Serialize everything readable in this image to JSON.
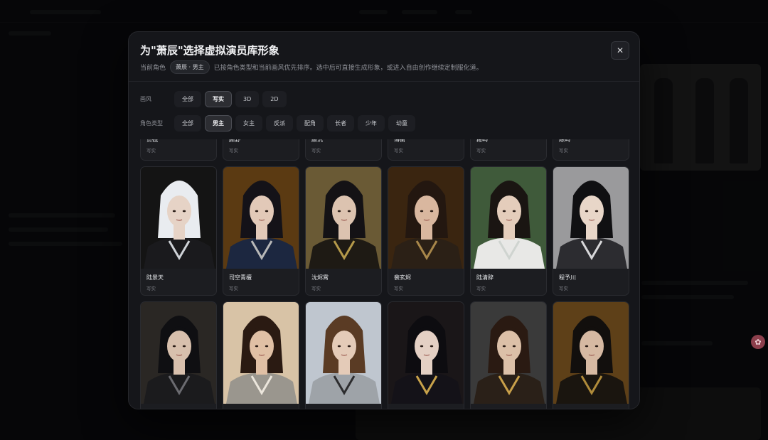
{
  "modal": {
    "title": "为\"萧辰\"选择虚拟演员库形象",
    "subtitle_prefix": "当前角色",
    "role_chip": "萧辰 · 男主",
    "subtitle_text": "已按角色类型和当前画风优先排序。选中后可直接生成形象，或进入自由创作继续定制服化道。",
    "close_glyph": "✕"
  },
  "filters": {
    "style": {
      "label": "画风",
      "options": [
        "全部",
        "写实",
        "3D",
        "2D"
      ],
      "selected": "写实"
    },
    "role_type": {
      "label": "角色类型",
      "options": [
        "全部",
        "男主",
        "女主",
        "反派",
        "配角",
        "长者",
        "少年",
        "幼童"
      ],
      "selected": "男主"
    }
  },
  "cards_top_partial": [
    {
      "name": "贺砚",
      "tag": "写实"
    },
    {
      "name": "顾野",
      "tag": "写实"
    },
    {
      "name": "顾沉",
      "tag": "写实"
    },
    {
      "name": "傅衡",
      "tag": "写实"
    },
    {
      "name": "段屿",
      "tag": "写实"
    },
    {
      "name": "陈屿",
      "tag": "写实"
    }
  ],
  "cards_row1": [
    {
      "name": "陆景天",
      "tag": "写实",
      "hair": "#e9ecf0",
      "skin": "#e6d3c6",
      "bg": "#141414",
      "cloth": "#1a1a1d",
      "accent": "#cfd3d8"
    },
    {
      "name": "司空青檀",
      "tag": "写实",
      "hair": "#141218",
      "skin": "#e2c9b8",
      "bg": "#5b3a12",
      "cloth": "#1c2740",
      "accent": "#b8b8b8"
    },
    {
      "name": "沈烬霄",
      "tag": "写实",
      "hair": "#141215",
      "skin": "#dcc3b0",
      "bg": "#6a5a35",
      "cloth": "#1e1a14",
      "accent": "#b59a4a"
    },
    {
      "name": "裴玄烬",
      "tag": "写实",
      "hair": "#231710",
      "skin": "#d9b79f",
      "bg": "#3a2510",
      "cloth": "#2b2016",
      "accent": "#a8874a"
    },
    {
      "name": "陆清辞",
      "tag": "写实",
      "hair": "#1a1512",
      "skin": "#e4cdbb",
      "bg": "#3f5a3a",
      "cloth": "#e8e8e6",
      "accent": "#cfd4d0"
    },
    {
      "name": "程予川",
      "tag": "写实",
      "hair": "#101012",
      "skin": "#e8d6c8",
      "bg": "#9a9a9c",
      "cloth": "#2c2c30",
      "accent": "#d8d8da"
    }
  ],
  "cards_row2": [
    {
      "name": "",
      "tag": "",
      "hair": "#0f0f12",
      "skin": "#d8c0ad",
      "bg": "#2a2724",
      "cloth": "#1b1b1d",
      "accent": "#6b6b70"
    },
    {
      "name": "",
      "tag": "",
      "hair": "#2a1a12",
      "skin": "#e0c0a5",
      "bg": "#d8c3a6",
      "cloth": "#9a968e",
      "accent": "#ece6dc"
    },
    {
      "name": "",
      "tag": "",
      "hair": "#5a3b24",
      "skin": "#e4cbb8",
      "bg": "#bfc6cf",
      "cloth": "#9ea3a8",
      "accent": "#2c2c2e"
    },
    {
      "name": "",
      "tag": "",
      "hair": "#0d0c10",
      "skin": "#e4d0c4",
      "bg": "#1a1618",
      "cloth": "#141218",
      "accent": "#c8a24a"
    },
    {
      "name": "",
      "tag": "",
      "hair": "#2a1a12",
      "skin": "#dcc0a8",
      "bg": "#3a3a3a",
      "cloth": "#2a2018",
      "accent": "#c9a04a"
    },
    {
      "name": "",
      "tag": "",
      "hair": "#120f0d",
      "skin": "#d6b9a2",
      "bg": "#5e4018",
      "cloth": "#1a150f",
      "accent": "#b08b3a"
    }
  ],
  "badge_glyph": "✿"
}
